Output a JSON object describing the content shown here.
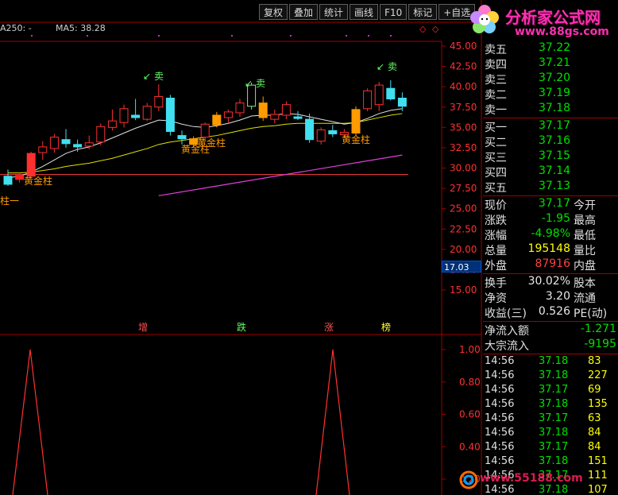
{
  "toolbar": {
    "buttons": [
      "复权",
      "叠加",
      "统计",
      "画线",
      "F10",
      "标记",
      "+自选"
    ]
  },
  "chart_header": {
    "ma250": "A250: -",
    "ma5": "MA5: 38.28"
  },
  "price_axis": [
    "45.00",
    "42.50",
    "40.00",
    "37.50",
    "35.00",
    "32.50",
    "30.00",
    "27.50",
    "25.00",
    "22.50",
    "20.00",
    "17.50",
    "15.00"
  ],
  "current_price_marker": "17.03",
  "signals": {
    "sell": "卖",
    "golden": "黄金柱",
    "golden_partial": "柱一",
    "labels": [
      "增",
      "跌",
      "涨",
      "榜"
    ]
  },
  "indicator_axis": [
    "1.00",
    "0.80",
    "0.60",
    "0.40",
    "0.20"
  ],
  "logo": {
    "main": "分析家公式网",
    "url": "www.88gs.com"
  },
  "watermark": "www.55188.com",
  "colors": {
    "up": "#ff3030",
    "down": "#40e0f0",
    "grid": "#a00000",
    "ma_white": "#e0e0e0",
    "ma_yellow": "#e0e000",
    "ma_magenta": "#e040e0",
    "golden": "#ff9a00",
    "signal_green": "#60ff60"
  },
  "asks": [
    {
      "label": "卖五",
      "price": "37.22"
    },
    {
      "label": "卖四",
      "price": "37.21"
    },
    {
      "label": "卖三",
      "price": "37.20"
    },
    {
      "label": "卖二",
      "price": "37.19"
    },
    {
      "label": "卖一",
      "price": "37.18"
    }
  ],
  "bids": [
    {
      "label": "买一",
      "price": "37.17"
    },
    {
      "label": "买二",
      "price": "37.16"
    },
    {
      "label": "买三",
      "price": "37.15"
    },
    {
      "label": "买四",
      "price": "37.14"
    },
    {
      "label": "买五",
      "price": "37.13"
    }
  ],
  "stats": [
    {
      "label": "现价",
      "value": "37.17",
      "label2": "今开",
      "color": "green"
    },
    {
      "label": "涨跌",
      "value": "-1.95",
      "label2": "最高",
      "color": "green"
    },
    {
      "label": "涨幅",
      "value": "-4.98%",
      "label2": "最低",
      "color": "green"
    },
    {
      "label": "总量",
      "value": "195148",
      "label2": "量比",
      "color": "yellow"
    },
    {
      "label": "外盘",
      "value": "87916",
      "label2": "内盘",
      "color": "red"
    }
  ],
  "fundamentals": [
    {
      "label": "换手",
      "value": "30.02%",
      "label2": "股本"
    },
    {
      "label": "净资",
      "value": "3.20",
      "label2": "流通"
    },
    {
      "label": "收益(三)",
      "value": "0.526",
      "label2": "PE(动)"
    }
  ],
  "flows": [
    {
      "label": "净流入额",
      "value": "-1.271"
    },
    {
      "label": "大宗流入",
      "value": "-9195"
    }
  ],
  "ticks": [
    {
      "time": "14:56",
      "price": "37.18",
      "vol": "83"
    },
    {
      "time": "14:56",
      "price": "37.18",
      "vol": "227"
    },
    {
      "time": "14:56",
      "price": "37.17",
      "vol": "69"
    },
    {
      "time": "14:56",
      "price": "37.18",
      "vol": "135"
    },
    {
      "time": "14:56",
      "price": "37.17",
      "vol": "63"
    },
    {
      "time": "14:56",
      "price": "37.18",
      "vol": "84"
    },
    {
      "time": "14:56",
      "price": "37.17",
      "vol": "84"
    },
    {
      "time": "14:56",
      "price": "37.18",
      "vol": "151"
    },
    {
      "time": "14:56",
      "price": "37.17",
      "vol": "111"
    },
    {
      "time": "14:56",
      "price": "37.18",
      "vol": "107"
    }
  ],
  "chart_data": {
    "type": "candlestick",
    "ylim": [
      13,
      46
    ],
    "candles": [
      {
        "o": 29.0,
        "h": 29.8,
        "l": 27.8,
        "c": 28.0
      },
      {
        "o": 28.6,
        "h": 29.4,
        "l": 28.2,
        "c": 29.1
      },
      {
        "o": 29.0,
        "h": 32.0,
        "l": 28.9,
        "c": 31.8
      },
      {
        "o": 31.9,
        "h": 33.3,
        "l": 31.0,
        "c": 32.6
      },
      {
        "o": 32.4,
        "h": 34.2,
        "l": 31.9,
        "c": 33.8
      },
      {
        "o": 33.5,
        "h": 34.8,
        "l": 32.5,
        "c": 33.0
      },
      {
        "o": 32.9,
        "h": 33.5,
        "l": 32.0,
        "c": 32.6
      },
      {
        "o": 32.7,
        "h": 34.0,
        "l": 32.3,
        "c": 33.1
      },
      {
        "o": 33.2,
        "h": 35.5,
        "l": 32.8,
        "c": 35.1
      },
      {
        "o": 35.0,
        "h": 37.2,
        "l": 34.6,
        "c": 35.8
      },
      {
        "o": 35.6,
        "h": 37.8,
        "l": 35.0,
        "c": 37.3
      },
      {
        "o": 36.5,
        "h": 38.5,
        "l": 35.9,
        "c": 36.2
      },
      {
        "o": 36.0,
        "h": 38.0,
        "l": 35.8,
        "c": 37.6
      },
      {
        "o": 37.5,
        "h": 40.3,
        "l": 37.0,
        "c": 38.8
      },
      {
        "o": 38.6,
        "h": 39.0,
        "l": 34.0,
        "c": 34.5
      },
      {
        "o": 34.0,
        "h": 34.6,
        "l": 32.9,
        "c": 33.6
      },
      {
        "o": 32.9,
        "h": 33.9,
        "l": 32.6,
        "c": 33.6
      },
      {
        "o": 33.8,
        "h": 35.6,
        "l": 33.4,
        "c": 35.4
      },
      {
        "o": 35.3,
        "h": 36.9,
        "l": 35.0,
        "c": 36.5
      },
      {
        "o": 36.2,
        "h": 37.2,
        "l": 35.5,
        "c": 36.9
      },
      {
        "o": 36.8,
        "h": 38.5,
        "l": 36.3,
        "c": 38.0
      },
      {
        "o": 37.6,
        "h": 40.5,
        "l": 37.2,
        "c": 40.2
      },
      {
        "o": 38.0,
        "h": 38.8,
        "l": 35.8,
        "c": 36.2
      },
      {
        "o": 36.0,
        "h": 37.2,
        "l": 35.5,
        "c": 36.6
      },
      {
        "o": 36.5,
        "h": 38.2,
        "l": 36.0,
        "c": 37.8
      },
      {
        "o": 36.3,
        "h": 37.0,
        "l": 35.9,
        "c": 36.1
      },
      {
        "o": 36.0,
        "h": 36.7,
        "l": 33.1,
        "c": 33.5
      },
      {
        "o": 33.3,
        "h": 35.0,
        "l": 32.9,
        "c": 34.7
      },
      {
        "o": 34.6,
        "h": 35.3,
        "l": 33.8,
        "c": 34.2
      },
      {
        "o": 34.1,
        "h": 34.8,
        "l": 33.7,
        "c": 34.4
      },
      {
        "o": 34.3,
        "h": 37.6,
        "l": 34.0,
        "c": 37.2
      },
      {
        "o": 37.3,
        "h": 39.8,
        "l": 37.0,
        "c": 39.5
      },
      {
        "o": 37.8,
        "h": 40.6,
        "l": 37.0,
        "c": 40.2
      },
      {
        "o": 39.8,
        "h": 40.8,
        "l": 38.3,
        "c": 38.5
      },
      {
        "o": 38.6,
        "h": 39.3,
        "l": 37.0,
        "c": 37.6
      }
    ],
    "ma_white": [
      28.8,
      29.0,
      29.5,
      30.2,
      31.0,
      31.8,
      32.3,
      32.6,
      33.1,
      33.7,
      34.3,
      34.9,
      35.4,
      35.9,
      35.8,
      35.4,
      35.1,
      35.0,
      35.2,
      35.5,
      35.9,
      36.4,
      36.5,
      36.5,
      36.7,
      36.6,
      36.3,
      36.0,
      35.7,
      35.4,
      35.6,
      36.1,
      36.7,
      37.1,
      37.3
    ],
    "ma_yellow": [
      29.4,
      29.4,
      29.5,
      29.7,
      29.9,
      30.2,
      30.4,
      30.6,
      30.9,
      31.2,
      31.6,
      32.0,
      32.4,
      32.9,
      33.2,
      33.4,
      33.6,
      33.8,
      34.0,
      34.3,
      34.6,
      34.9,
      35.1,
      35.2,
      35.4,
      35.5,
      35.5,
      35.5,
      35.5,
      35.5,
      35.6,
      35.9,
      36.2,
      36.5,
      36.7
    ],
    "ma_magenta_range": [
      26.6,
      31.6
    ],
    "golden_candles": [
      1,
      16,
      18,
      22,
      30
    ],
    "indicator_peaks": [
      1.0,
      1.0
    ]
  }
}
